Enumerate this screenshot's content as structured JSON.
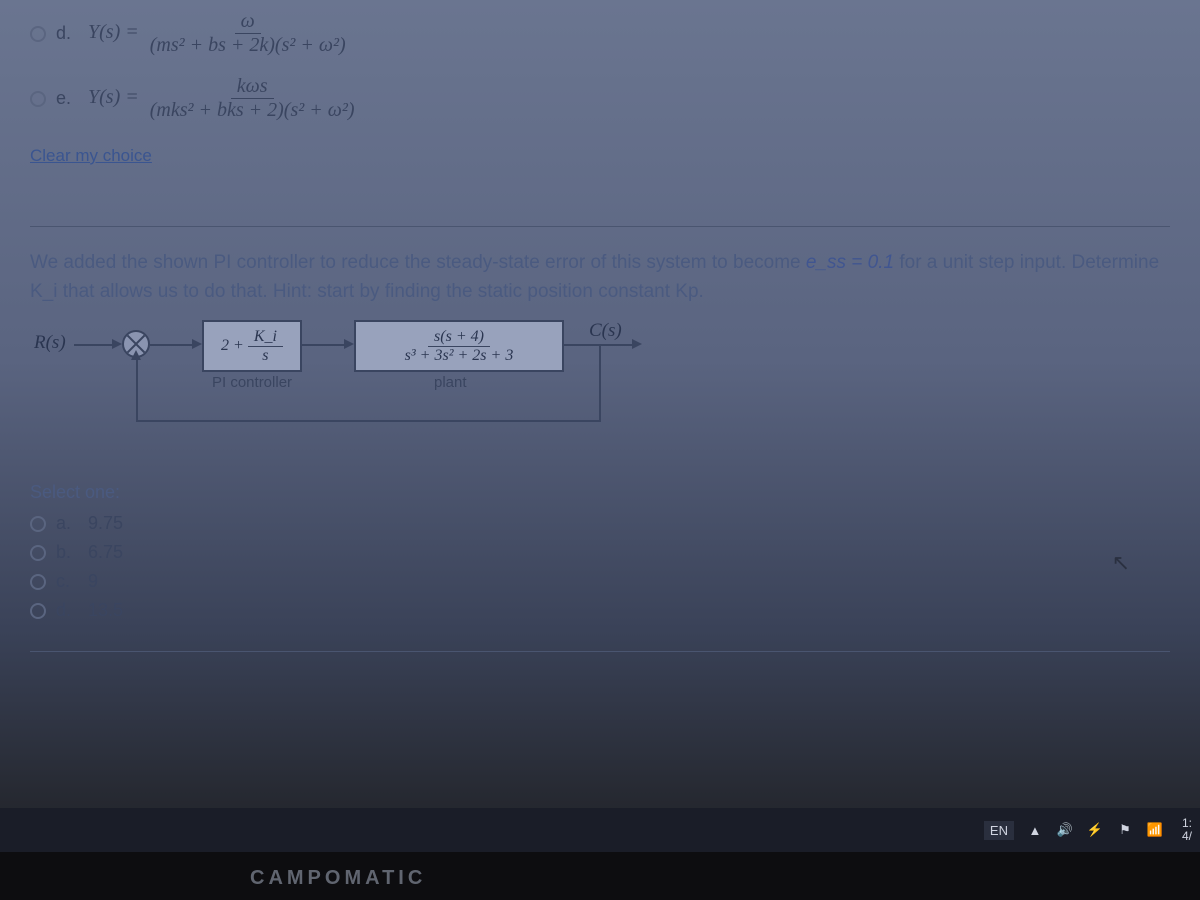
{
  "question1": {
    "options": [
      {
        "letter": "d.",
        "lhs": "Y(s) =",
        "num": "ω",
        "den": "(ms² + bs + 2k)(s² + ω²)"
      },
      {
        "letter": "e.",
        "lhs": "Y(s) =",
        "num": "kωs",
        "den": "(mks² + bks + 2)(s² + ω²)"
      }
    ],
    "clear": "Clear my choice"
  },
  "question2": {
    "text_a": "We added the shown PI controller to reduce the steady-state error of this system to become ",
    "ess": "e_ss = 0.1",
    "text_b": " for a unit step input. Determine K_i that allows us to do that. Hint: start by finding the static position constant Kp.",
    "diagram": {
      "input": "R(s)",
      "output": "C(s)",
      "pi_block": {
        "gain": "2 +",
        "num": "K_i",
        "den": "s",
        "label": "PI controller"
      },
      "plant_block": {
        "num": "s(s + 4)",
        "den": "s³ + 3s² + 2s + 3",
        "label": "plant"
      }
    },
    "select_one": "Select one:",
    "options": [
      {
        "letter": "a.",
        "value": "9.75"
      },
      {
        "letter": "b.",
        "value": "6.75"
      },
      {
        "letter": "c.",
        "value": "9"
      },
      {
        "letter": "d.",
        "value": "13.5"
      }
    ]
  },
  "taskbar": {
    "lang": "EN",
    "icons": {
      "up": "▲",
      "sound": "🔊",
      "battery": "⚡",
      "flag": "⚑",
      "net": "📶"
    },
    "time": "1:",
    "date": "4/"
  },
  "brand": "CAMPOMATIC"
}
